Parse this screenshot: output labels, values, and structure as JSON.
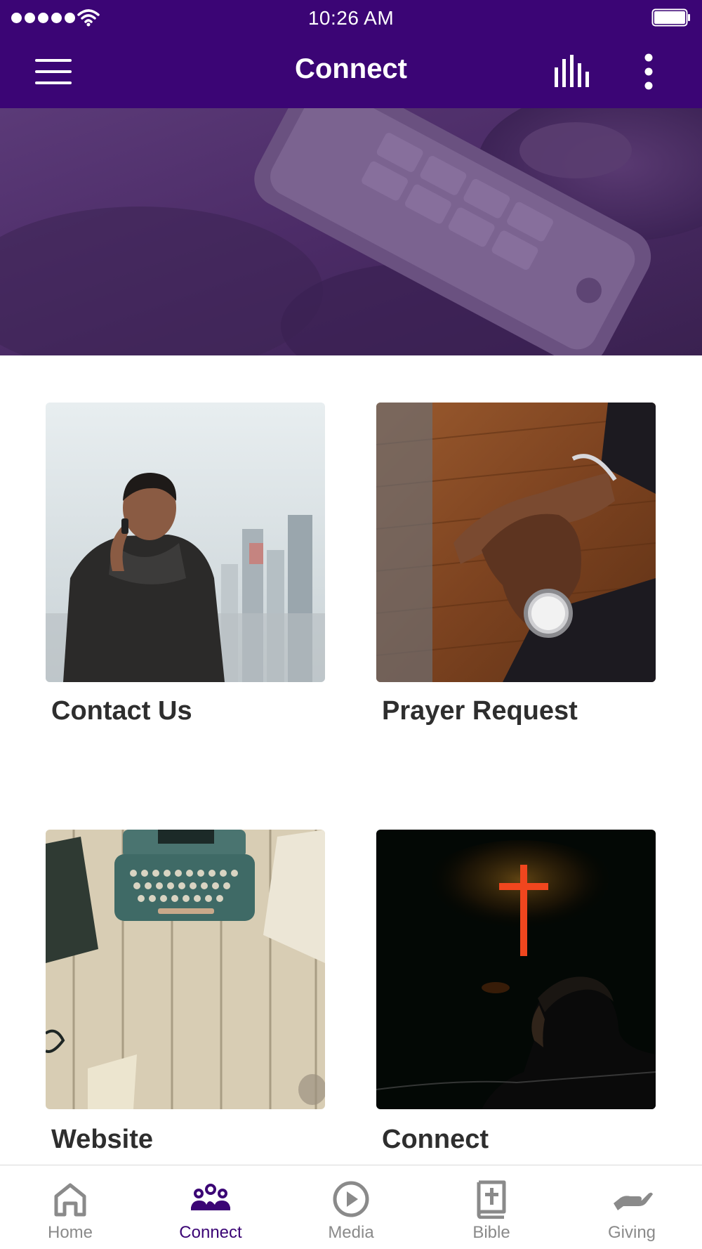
{
  "status_bar": {
    "time": "10:26 AM",
    "signal_icon": "signal-dots-icon",
    "wifi_icon": "wifi-icon",
    "battery_icon": "battery-icon"
  },
  "app_bar": {
    "title": "Connect",
    "menu_icon": "hamburger-menu-icon",
    "audio_icon": "equalizer-icon",
    "more_icon": "more-vertical-icon"
  },
  "hero": {
    "image": "phone-in-hands-photo"
  },
  "tiles": [
    {
      "label": "Contact Us",
      "image": "man-on-phone-photo"
    },
    {
      "label": "Prayer Request",
      "image": "folded-hands-photo"
    },
    {
      "label": "Website",
      "image": "typewriter-photo"
    },
    {
      "label": "Connect",
      "image": "cross-silhouette-photo"
    }
  ],
  "bottom_nav": {
    "active": "Connect",
    "items": [
      {
        "label": "Home",
        "icon": "home-icon"
      },
      {
        "label": "Connect",
        "icon": "people-group-icon"
      },
      {
        "label": "Media",
        "icon": "play-circle-icon"
      },
      {
        "label": "Bible",
        "icon": "bible-icon"
      },
      {
        "label": "Giving",
        "icon": "giving-hand-icon"
      }
    ]
  },
  "colors": {
    "brand_purple": "#3b0575",
    "label_dark": "#2e2e2e",
    "nav_inactive": "#8a8a8a"
  }
}
